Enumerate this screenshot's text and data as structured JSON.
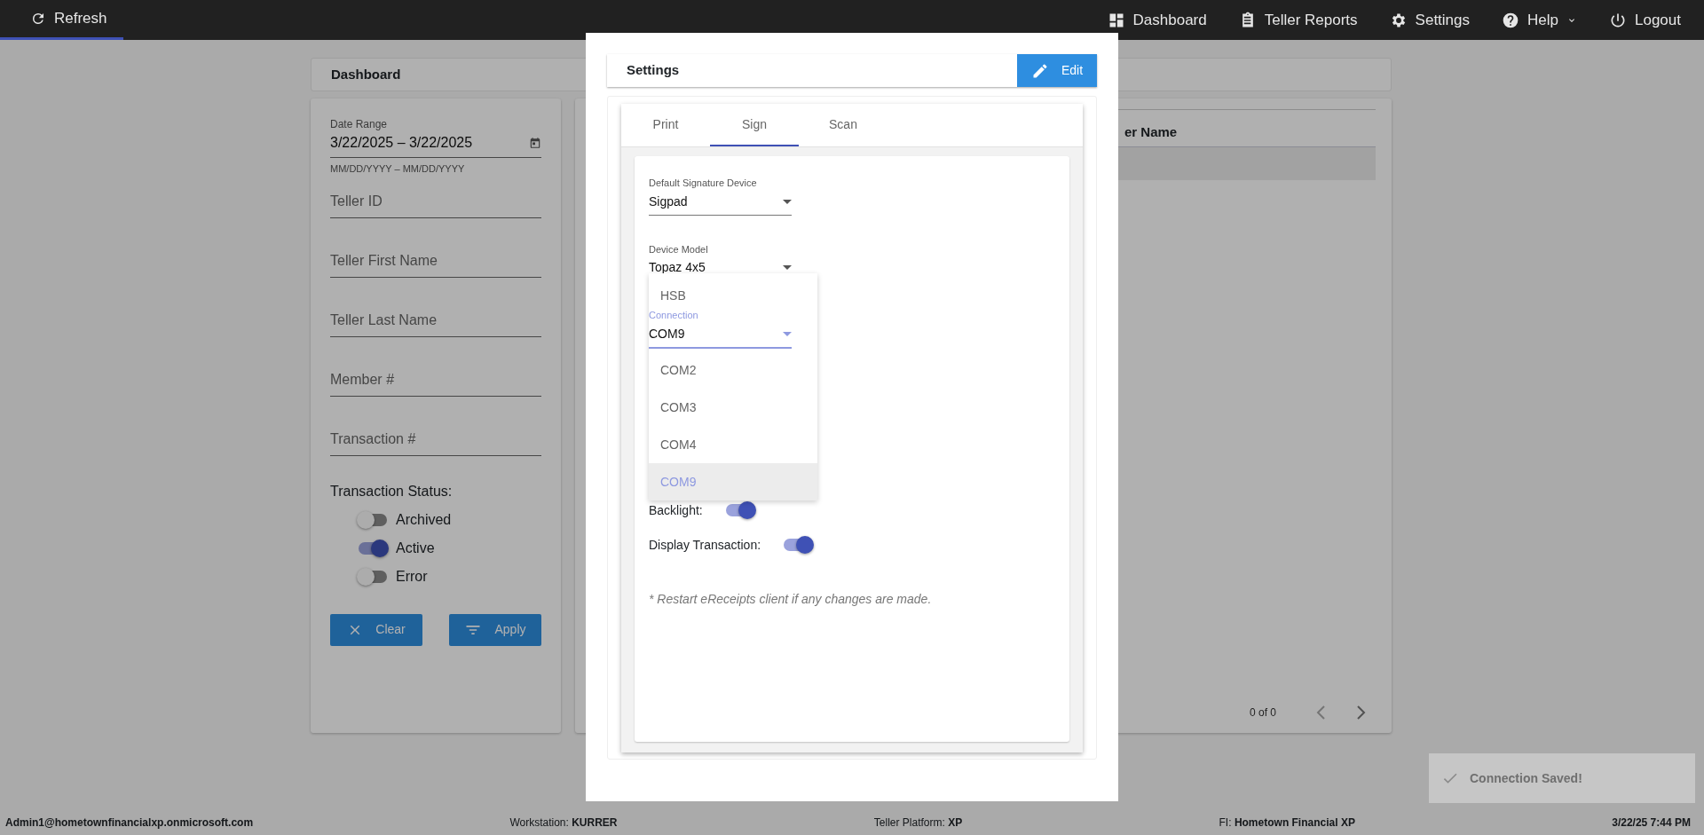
{
  "navbar": {
    "refresh": {
      "label": "Refresh",
      "selected": true
    },
    "items": [
      {
        "label": "Dashboard",
        "dropdown": false
      },
      {
        "label": "Teller Reports",
        "dropdown": false
      },
      {
        "label": "Settings",
        "dropdown": false
      },
      {
        "label": "Help",
        "dropdown": true
      },
      {
        "label": "Logout",
        "dropdown": false
      }
    ]
  },
  "dashboard": {
    "title": "Dashboard"
  },
  "filters": {
    "date_range": {
      "label": "Date Range",
      "value": "3/22/2025 – 3/22/2025",
      "hint": "MM/DD/YYYY – MM/DD/YYYY"
    },
    "fields": [
      {
        "placeholder": "Teller ID"
      },
      {
        "placeholder": "Teller First Name"
      },
      {
        "placeholder": "Teller Last Name"
      },
      {
        "placeholder": "Member #"
      },
      {
        "placeholder": "Transaction #"
      }
    ],
    "status_label": "Transaction Status:",
    "statuses": [
      {
        "label": "Archived",
        "on": false
      },
      {
        "label": "Active",
        "on": true
      },
      {
        "label": "Error",
        "on": false
      }
    ],
    "buttons": [
      {
        "label": "Clear",
        "kind": "clear"
      },
      {
        "label": "Apply",
        "kind": "apply"
      }
    ]
  },
  "results": {
    "column_header": "er Name",
    "pagination": "0 of 0"
  },
  "modal": {
    "title": "Settings",
    "edit_button": "Edit",
    "tabs": [
      {
        "label": "Print",
        "selected": false
      },
      {
        "label": "Sign",
        "selected": true
      },
      {
        "label": "Scan",
        "selected": false
      }
    ],
    "fields": [
      {
        "label": "Default Signature Device",
        "value": "Sigpad",
        "focused": false,
        "disabled": false
      },
      {
        "label": "Device Model",
        "value": "Topaz 4x5",
        "focused": false,
        "disabled": false
      },
      {
        "label": "Connection",
        "value": "COM9",
        "focused": true,
        "disabled": false
      }
    ],
    "menu": [
      {
        "label": "HSB",
        "selected": false
      },
      {
        "label": "COM2",
        "selected": false
      },
      {
        "label": "COM3",
        "selected": false
      },
      {
        "label": "COM4",
        "selected": false
      },
      {
        "label": "COM9",
        "selected": true
      }
    ],
    "toggles": [
      {
        "label": "Backlight:",
        "on": true
      },
      {
        "label": "Display Transaction:",
        "on": true
      }
    ],
    "note": "* Restart eReceipts client if any changes are made."
  },
  "toast": {
    "message": "Connection Saved!"
  },
  "status_bar": {
    "user": "Admin1@hometownfinancialxp.onmicrosoft.com",
    "items": [
      {
        "label": "Workstation:",
        "value": "KURRER"
      },
      {
        "label": "Teller Platform:",
        "value": "XP"
      },
      {
        "label": "FI:",
        "value": "Hometown Financial XP"
      }
    ],
    "datetime": "3/22/25 7:44 PM"
  }
}
